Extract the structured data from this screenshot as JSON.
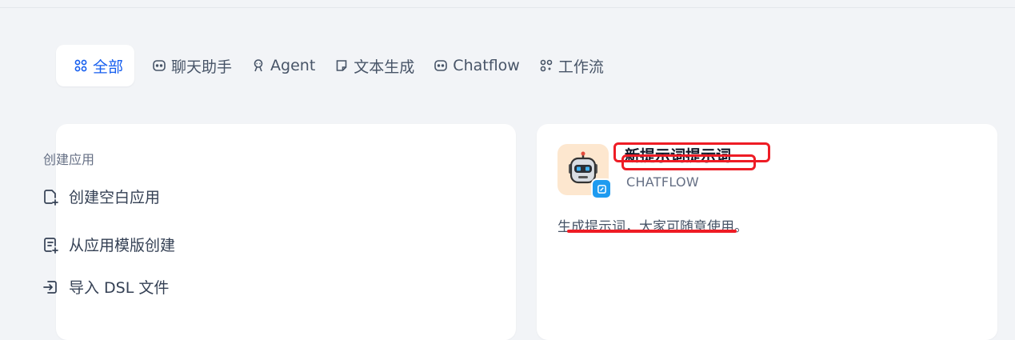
{
  "tabs": [
    {
      "label": "全部",
      "icon": "grid-icon",
      "active": true
    },
    {
      "label": "聊天助手",
      "icon": "chat-icon",
      "active": false
    },
    {
      "label": "Agent",
      "icon": "agent-icon",
      "active": false
    },
    {
      "label": "文本生成",
      "icon": "document-icon",
      "active": false
    },
    {
      "label": "Chatflow",
      "icon": "chatflow-icon",
      "active": false
    },
    {
      "label": "工作流",
      "icon": "workflow-icon",
      "active": false
    }
  ],
  "create_card": {
    "title": "创建应用",
    "items": [
      {
        "label": "创建空白应用",
        "icon": "file-plus-icon"
      },
      {
        "label": "从应用模版创建",
        "icon": "template-icon"
      },
      {
        "label": "导入 DSL 文件",
        "icon": "import-icon"
      }
    ]
  },
  "app_card": {
    "name": "新提示词提示词",
    "type": "CHATFLOW",
    "description": "生成提示词，大家可随意使用。",
    "avatar_icon": "robot-icon",
    "badge_icon": "chatflow-badge-icon",
    "redaction_color": "#ee1c25"
  },
  "colors": {
    "accent": "#155eef",
    "background": "#f2f4f7",
    "card": "#ffffff"
  }
}
